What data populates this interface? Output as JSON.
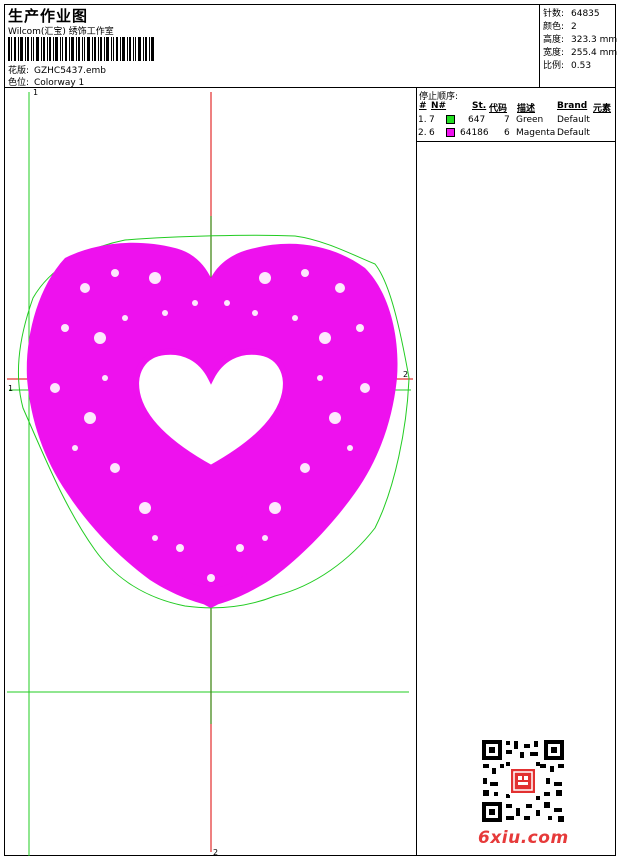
{
  "header": {
    "title": "生产作业图",
    "company": "Wilcom(汇宝) 绣饰工作室",
    "design_label": "花版:",
    "design_value": "GZHC5437.emb",
    "colorway_label": "色位:",
    "colorway_value": "Colorway 1"
  },
  "stats": [
    {
      "label": "针数:",
      "value": "64835"
    },
    {
      "label": "颜色:",
      "value": "2"
    },
    {
      "label": "高度:",
      "value": "323.3 mm"
    },
    {
      "label": "宽度:",
      "value": "255.4 mm"
    },
    {
      "label": "比例:",
      "value": "0.53"
    }
  ],
  "sequence": {
    "title": "停止顺序:",
    "headers": [
      "#",
      "N#",
      "St.",
      "代码",
      "描述",
      "Brand",
      "元素"
    ],
    "rows": [
      {
        "idx": "1.",
        "needle": "7",
        "color": "#22dd22",
        "stitches": "647",
        "code": "7",
        "desc": "Green",
        "brand": "Default"
      },
      {
        "idx": "2.",
        "needle": "6",
        "color": "#ee11ee",
        "stitches": "64186",
        "code": "6",
        "desc": "Magenta",
        "brand": "Default"
      }
    ]
  },
  "guides": {
    "v1": "1",
    "v2": "2",
    "h1": "1",
    "h2": "2"
  },
  "colors": {
    "accent_green": "#22cc22",
    "accent_magenta": "#ee11ee",
    "axis_red": "#dd0000"
  },
  "watermark": "6xiu.com",
  "qr_icon": "qr-code-icon"
}
